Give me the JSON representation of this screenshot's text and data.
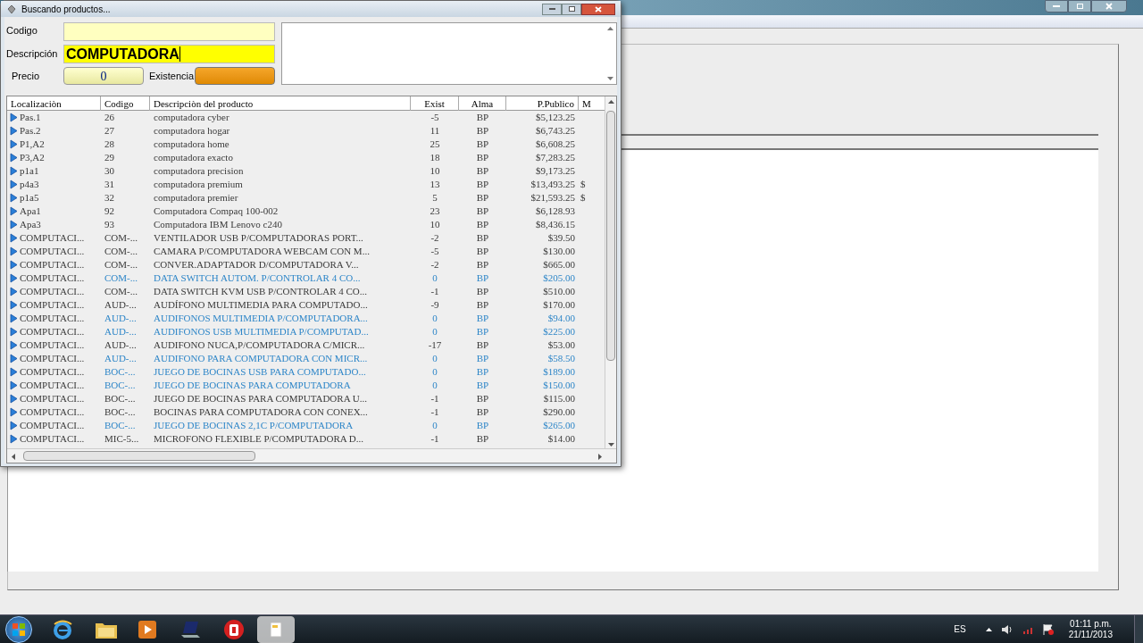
{
  "dialog": {
    "title": "Buscando productos...",
    "fields": [
      {
        "kind": "codigo",
        "label": "Codigo"
      },
      {
        "kind": "descripcion",
        "label": "Descripción",
        "value": "COMPUTADORA"
      },
      {
        "kind": "precio",
        "label": "Precio",
        "value": "0"
      },
      {
        "kind": "existencia",
        "label": "Existencia"
      }
    ],
    "table": {
      "columns": [
        "Localizaciòn",
        "Codigo",
        "Descripciòn del producto",
        "Exist",
        "Alma",
        "P.Publico",
        "M"
      ],
      "rows": [
        {
          "cells": [
            "Pas.1",
            "26",
            "computadora cyber",
            "-5",
            "BP",
            "$5,123.25"
          ],
          "highlighted": false
        },
        {
          "cells": [
            "Pas.2",
            "27",
            "computadora hogar",
            "11",
            "BP",
            "$6,743.25"
          ],
          "highlighted": false
        },
        {
          "cells": [
            "P1,A2",
            "28",
            "computadora home",
            "25",
            "BP",
            "$6,608.25"
          ],
          "highlighted": false
        },
        {
          "cells": [
            "P3,A2",
            "29",
            "computadora exacto",
            "18",
            "BP",
            "$7,283.25"
          ],
          "highlighted": false
        },
        {
          "cells": [
            "p1a1",
            "30",
            "computadora precision",
            "10",
            "BP",
            "$9,173.25"
          ],
          "highlighted": false
        },
        {
          "cells": [
            "p4a3",
            "31",
            "computadora premium",
            "13",
            "BP",
            "$13,493.25",
            "$"
          ],
          "highlighted": false
        },
        {
          "cells": [
            "p1a5",
            "32",
            "computadora premier",
            "5",
            "BP",
            "$21,593.25",
            "$"
          ],
          "highlighted": false
        },
        {
          "cells": [
            "Apa1",
            "92",
            "Computadora Compaq 100-002",
            "23",
            "BP",
            "$6,128.93"
          ],
          "highlighted": false
        },
        {
          "cells": [
            "Apa3",
            "93",
            "Computadora IBM Lenovo c240",
            "10",
            "BP",
            "$8,436.15"
          ],
          "highlighted": false
        },
        {
          "cells": [
            "COMPUTACI...",
            "COM-...",
            "VENTILADOR USB P/COMPUTADORAS PORT...",
            "-2",
            "BP",
            "$39.50"
          ],
          "highlighted": false
        },
        {
          "cells": [
            "COMPUTACI...",
            "COM-...",
            "CAMARA P/COMPUTADORA WEBCAM CON M...",
            "-5",
            "BP",
            "$130.00"
          ],
          "highlighted": false
        },
        {
          "cells": [
            "COMPUTACI...",
            "COM-...",
            "CONVER.ADAPTADOR D/COMPUTADORA V...",
            "-2",
            "BP",
            "$665.00"
          ],
          "highlighted": false
        },
        {
          "cells": [
            "COMPUTACI...",
            "COM-...",
            "DATA SWITCH AUTOM. P/CONTROLAR 4 CO...",
            "0",
            "BP",
            "$205.00"
          ],
          "highlighted": true
        },
        {
          "cells": [
            "COMPUTACI...",
            "COM-...",
            "DATA SWITCH KVM USB P/CONTROLAR 4 CO...",
            "-1",
            "BP",
            "$510.00"
          ],
          "highlighted": false
        },
        {
          "cells": [
            "COMPUTACI...",
            "AUD-...",
            "AUDÍFONO MULTIMEDIA PARA COMPUTADO...",
            "-9",
            "BP",
            "$170.00"
          ],
          "highlighted": false
        },
        {
          "cells": [
            "COMPUTACI...",
            "AUD-...",
            "AUDIFONOS MULTIMEDIA P/COMPUTADORA...",
            "0",
            "BP",
            "$94.00"
          ],
          "highlighted": true
        },
        {
          "cells": [
            "COMPUTACI...",
            "AUD-...",
            "AUDIFONOS USB MULTIMEDIA P/COMPUTAD...",
            "0",
            "BP",
            "$225.00"
          ],
          "highlighted": true
        },
        {
          "cells": [
            "COMPUTACI...",
            "AUD-...",
            "AUDIFONO NUCA,P/COMPUTADORA C/MICR...",
            "-17",
            "BP",
            "$53.00"
          ],
          "highlighted": false
        },
        {
          "cells": [
            "COMPUTACI...",
            "AUD-...",
            "AUDIFONO PARA COMPUTADORA CON MICR...",
            "0",
            "BP",
            "$58.50"
          ],
          "highlighted": true
        },
        {
          "cells": [
            "COMPUTACI...",
            "BOC-...",
            "JUEGO DE BOCINAS USB PARA COMPUTADO...",
            "0",
            "BP",
            "$189.00"
          ],
          "highlighted": true
        },
        {
          "cells": [
            "COMPUTACI...",
            "BOC-...",
            "JUEGO DE BOCINAS PARA COMPUTADORA",
            "0",
            "BP",
            "$150.00"
          ],
          "highlighted": true
        },
        {
          "cells": [
            "COMPUTACI...",
            "BOC-...",
            "JUEGO DE BOCINAS PARA COMPUTADORA U...",
            "-1",
            "BP",
            "$115.00"
          ],
          "highlighted": false
        },
        {
          "cells": [
            "COMPUTACI...",
            "BOC-...",
            "BOCINAS PARA COMPUTADORA CON CONEX...",
            "-1",
            "BP",
            "$290.00"
          ],
          "highlighted": false
        },
        {
          "cells": [
            "COMPUTACI...",
            "BOC-...",
            "JUEGO DE BOCINAS 2,1C P/COMPUTADORA",
            "0",
            "BP",
            "$265.00"
          ],
          "highlighted": true
        },
        {
          "cells": [
            "COMPUTACI...",
            "MIC-5...",
            "MICROFONO FLEXIBLE P/COMPUTADORA D...",
            "-1",
            "BP",
            "$14.00"
          ],
          "highlighted": false
        }
      ]
    }
  },
  "taskbar": {
    "language": "ES",
    "time": "01:11 p.m.",
    "date": "21/11/2013"
  }
}
